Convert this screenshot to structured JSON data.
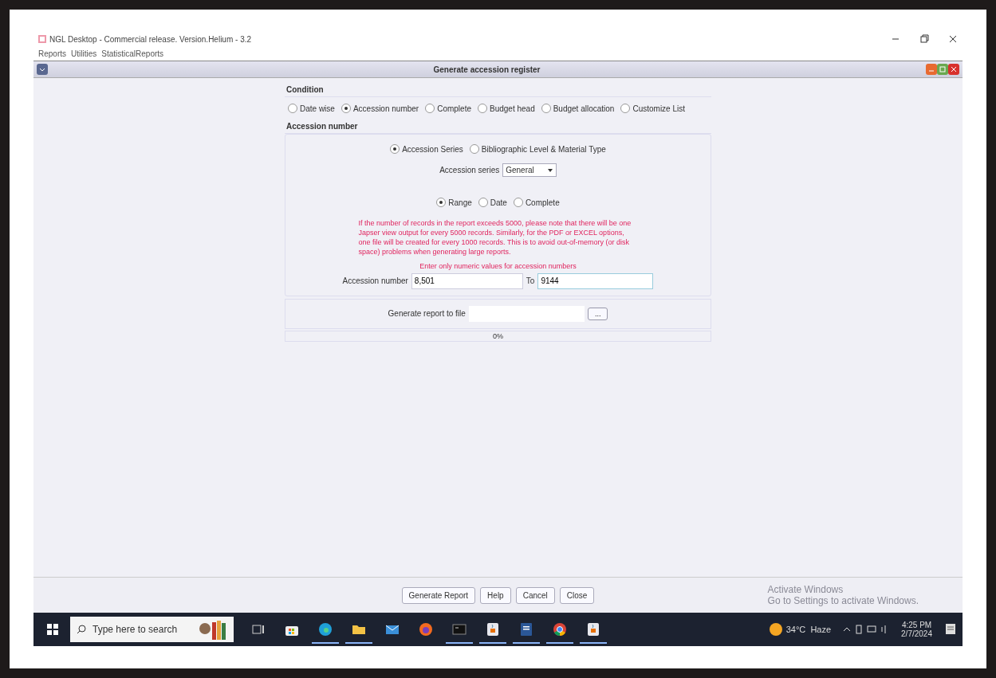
{
  "window": {
    "title": "NGL Desktop - Commercial release. Version.Helium - 3.2"
  },
  "menu": [
    "Reports",
    "Utilities",
    "StatisticalReports"
  ],
  "dialog": {
    "title": "Generate accession register"
  },
  "condition": {
    "heading": "Condition",
    "options": [
      {
        "label": "Date wise",
        "selected": false
      },
      {
        "label": "Accession number",
        "selected": true
      },
      {
        "label": "Complete",
        "selected": false
      },
      {
        "label": "Budget head",
        "selected": false
      },
      {
        "label": "Budget allocation",
        "selected": false
      },
      {
        "label": "Customize List",
        "selected": false
      }
    ]
  },
  "accession": {
    "heading": "Accession number",
    "source_options": [
      {
        "label": "Accession Series",
        "selected": true
      },
      {
        "label": "Bibliographic Level & Material Type",
        "selected": false
      }
    ],
    "series_label": "Accession series",
    "series_value": "General",
    "mode_options": [
      {
        "label": "Range",
        "selected": true
      },
      {
        "label": "Date",
        "selected": false
      },
      {
        "label": "Complete",
        "selected": false
      }
    ],
    "warning": "If the number of records in the report exceeds 5000, please note that there will be one Japser view output for every 5000 records. Similarly, for the PDF or EXCEL options, one file will be created for every 1000 records. This is to avoid out-of-memory (or disk space) problems when generating large reports.",
    "hint": "Enter only numeric values for accession numbers",
    "from_label": "Accession number",
    "from_value": "8,501",
    "to_label": "To",
    "to_value": "9144"
  },
  "output": {
    "label": "Generate report to file",
    "browse": "...",
    "progress_text": "0%"
  },
  "buttons": [
    "Generate Report",
    "Help",
    "Cancel",
    "Close"
  ],
  "watermark": [
    "Activate Windows",
    "Go to Settings to activate Windows."
  ],
  "taskbar": {
    "search_placeholder": "Type here to search",
    "apps": [
      {
        "kind": "taskview",
        "running": false
      },
      {
        "kind": "store",
        "running": false
      },
      {
        "kind": "edge",
        "running": true
      },
      {
        "kind": "folder",
        "running": true
      },
      {
        "kind": "mail",
        "running": false
      },
      {
        "kind": "firefox",
        "running": false
      },
      {
        "kind": "terminal",
        "running": true
      },
      {
        "kind": "java",
        "running": true
      },
      {
        "kind": "word",
        "running": true
      },
      {
        "kind": "chrome",
        "running": true
      },
      {
        "kind": "java",
        "running": true
      }
    ],
    "weather": "34°C  Haze",
    "time": "4:25 PM",
    "date": "2/7/2024"
  }
}
